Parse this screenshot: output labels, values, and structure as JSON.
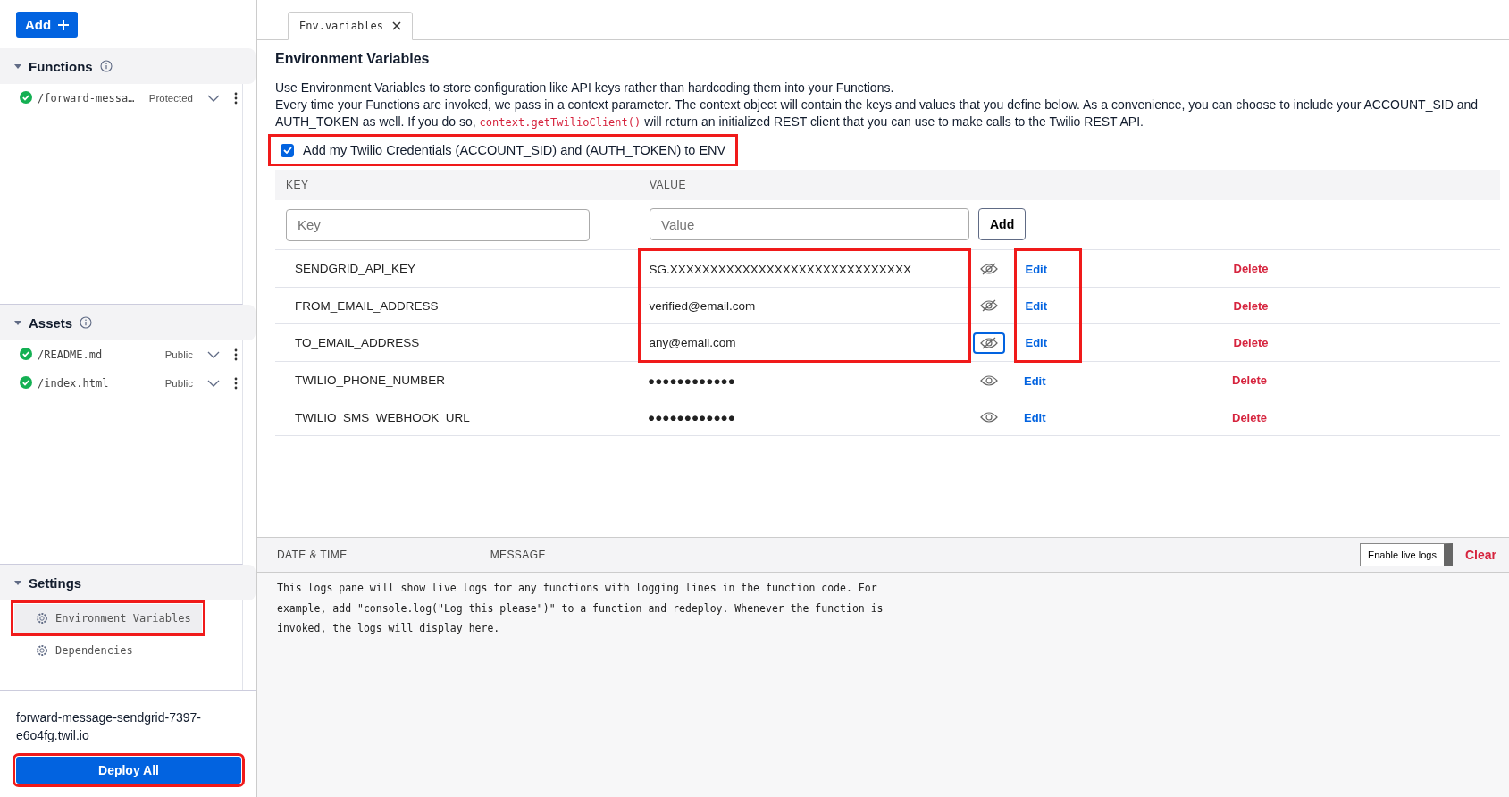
{
  "sidebar": {
    "add_button": "Add",
    "sections": [
      {
        "title": "Functions",
        "info": true,
        "expanded": true,
        "items": [
          {
            "name": "/forward-messa…",
            "visibility": "Protected",
            "deployed": true
          }
        ]
      },
      {
        "title": "Assets",
        "info": true,
        "expanded": true,
        "items": [
          {
            "name": "/README.md",
            "visibility": "Public",
            "deployed": true
          },
          {
            "name": "/index.html",
            "visibility": "Public",
            "deployed": true
          }
        ]
      },
      {
        "title": "Settings",
        "info": false,
        "expanded": true,
        "settings": [
          {
            "label": "Environment Variables",
            "selected": true,
            "highlighted": true
          },
          {
            "label": "Dependencies",
            "selected": false,
            "highlighted": false
          }
        ]
      }
    ],
    "domain": "forward-message-sendgrid-7397-e6o4fg.twil.io",
    "deploy_button": {
      "label": "Deploy All",
      "highlighted": true
    }
  },
  "tabs": [
    {
      "label": "Env.variables",
      "selected": true
    }
  ],
  "env": {
    "title": "Environment Variables",
    "description_1": "Use Environment Variables to store configuration like API keys rather than hardcoding them into your Functions.",
    "description_2_start": "Every time your Functions are invoked, we pass in a context parameter. The context object will contain the keys and values that you define below. As a convenience, you can choose to include your ACCOUNT_SID and AUTH_TOKEN as well. If you do so,",
    "description_code": "context.getTwilioClient()",
    "description_2_end": "will return an initialized REST client that you can use to make calls to the Twilio REST API.",
    "credentials_checkbox": {
      "label": "Add my Twilio Credentials (ACCOUNT_SID) and (AUTH_TOKEN) to ENV",
      "checked": true,
      "highlighted": true
    },
    "table": {
      "columns": [
        "KEY",
        "VALUE"
      ],
      "key_placeholder": "Key",
      "value_placeholder": "Value",
      "add_button": "Add",
      "rows": [
        {
          "key": "SENDGRID_API_KEY",
          "value": "SG.XXXXXXXXXXXXXXXXXXXXXXXXXXXXXX",
          "revealed": true,
          "focused": false,
          "edit": "Edit",
          "delete": "Delete",
          "highlight_value": true,
          "highlight_edit": true
        },
        {
          "key": "FROM_EMAIL_ADDRESS",
          "value": "verified@email.com",
          "revealed": true,
          "focused": false,
          "edit": "Edit",
          "delete": "Delete",
          "highlight_value": true,
          "highlight_edit": true
        },
        {
          "key": "TO_EMAIL_ADDRESS",
          "value": "any@email.com",
          "revealed": true,
          "focused": true,
          "edit": "Edit",
          "delete": "Delete",
          "highlight_value": true,
          "highlight_edit": true
        },
        {
          "key": "TWILIO_PHONE_NUMBER",
          "value": "●●●●●●●●●●●●",
          "revealed": false,
          "focused": false,
          "edit": "Edit",
          "delete": "Delete",
          "highlight_value": false,
          "highlight_edit": false
        },
        {
          "key": "TWILIO_SMS_WEBHOOK_URL",
          "value": "●●●●●●●●●●●●",
          "revealed": false,
          "focused": false,
          "edit": "Edit",
          "delete": "Delete",
          "highlight_value": false,
          "highlight_edit": false
        }
      ]
    }
  },
  "logs": {
    "columns": [
      "DATE & TIME",
      "MESSAGE"
    ],
    "live_logs_button": {
      "label": "Enable live logs",
      "on": false
    },
    "clear_button": "Clear",
    "message": "This logs pane will show live logs for any functions with logging lines in the function code. For example, add \"console.log(\"Log this please\")\" to a function and redeploy. Whenever the function is invoked, the logs will display here."
  }
}
